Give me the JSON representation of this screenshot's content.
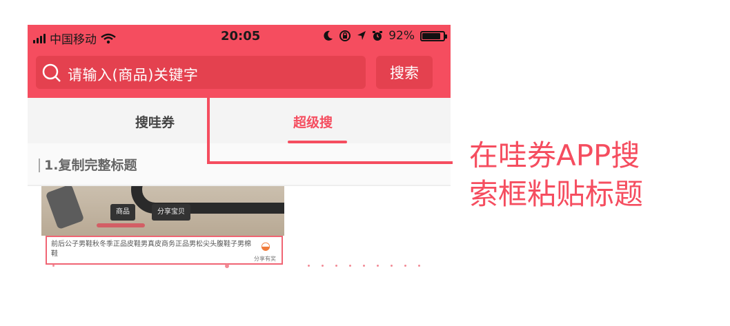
{
  "status_bar": {
    "carrier": "中国移动",
    "time": "20:05",
    "battery": "92%"
  },
  "search": {
    "placeholder": "请输入(商品)关键字",
    "button_label": "搜索"
  },
  "tabs": [
    {
      "label": "搜哇券",
      "active": false
    },
    {
      "label": "超级搜",
      "active": true
    }
  ],
  "step": {
    "text": "1.复制完整标题"
  },
  "product": {
    "chip_a": "商品",
    "chip_b": "分享宝贝",
    "title": "前后公子男鞋秋冬季正品皮鞋男真皮商务正品男松尖头腹鞋子男棉鞋",
    "share_label": "分享有奖"
  },
  "annotation": {
    "line1": "在哇券APP搜",
    "line2": "索框粘贴标题"
  },
  "colors": {
    "brand": "#f54d5f",
    "highlight_underline": "#f6d23a"
  }
}
